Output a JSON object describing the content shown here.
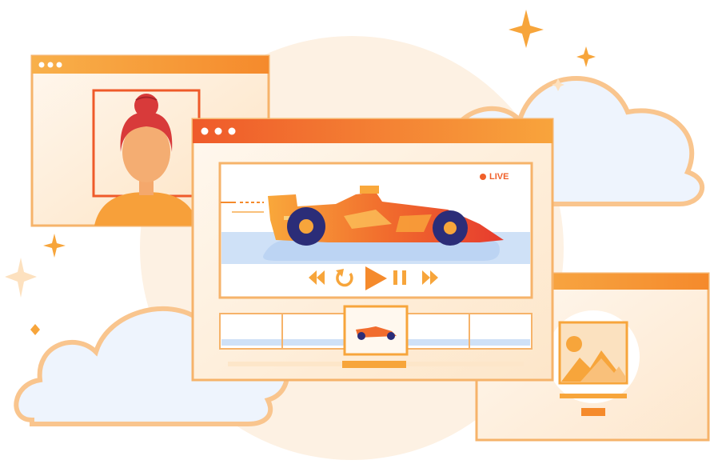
{
  "player": {
    "live_label": "LIVE",
    "controls": [
      "rewind",
      "replay",
      "play",
      "pause",
      "fast-forward"
    ],
    "timeline_thumbnails": 5,
    "selected_thumbnail_index": 2
  },
  "icons": {
    "rewind": "rewind-icon",
    "replay": "replay-icon",
    "play": "play-icon",
    "pause": "pause-icon",
    "forward": "fast-forward-icon",
    "image": "image-placeholder-icon"
  },
  "colors": {
    "accent_orange": "#f68b1f",
    "accent_red": "#ef5a2a",
    "frame_border": "#f6b36a",
    "cloud_fill": "#eef4fd",
    "road_blue": "#cfe1f7",
    "wheel_navy": "#2b2d78",
    "backdrop_peach": "#fdf1e3"
  }
}
